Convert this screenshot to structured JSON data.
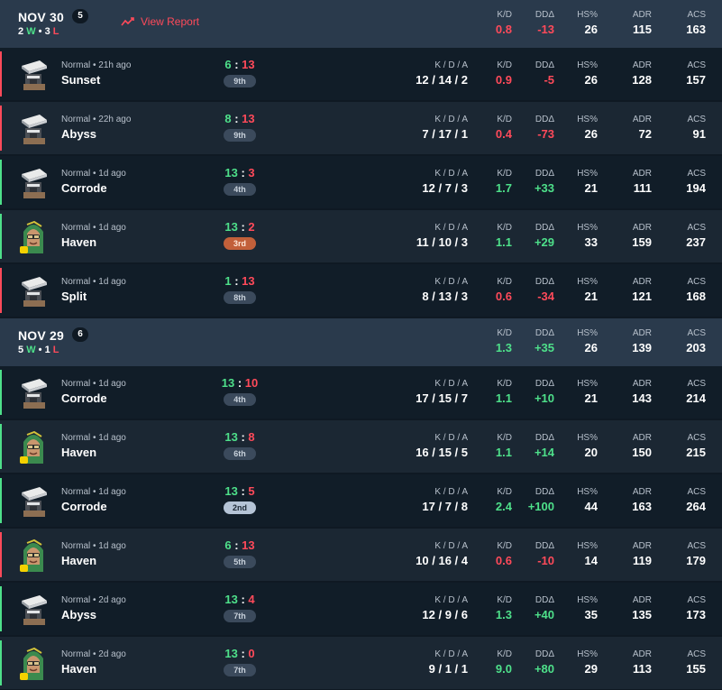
{
  "headers": [
    {
      "date": "NOV 30",
      "count": "5",
      "wins": "2",
      "w_letter": "W",
      "dot": "•",
      "losses": "3",
      "l_letter": "L",
      "view_report": "View Report",
      "stats": [
        {
          "label": "K/D",
          "value": "0.8",
          "tone": "red"
        },
        {
          "label": "DDΔ",
          "value": "-13",
          "tone": "red"
        },
        {
          "label": "HS%",
          "value": "26",
          "tone": "white"
        },
        {
          "label": "ADR",
          "value": "115",
          "tone": "white"
        },
        {
          "label": "ACS",
          "value": "163",
          "tone": "white"
        }
      ]
    },
    {
      "date": "NOV 29",
      "count": "6",
      "wins": "5",
      "w_letter": "W",
      "dot": "•",
      "losses": "1",
      "l_letter": "L",
      "view_report": "",
      "stats": [
        {
          "label": "K/D",
          "value": "1.3",
          "tone": "green"
        },
        {
          "label": "DDΔ",
          "value": "+35",
          "tone": "green"
        },
        {
          "label": "HS%",
          "value": "26",
          "tone": "white"
        },
        {
          "label": "ADR",
          "value": "139",
          "tone": "white"
        },
        {
          "label": "ACS",
          "value": "203",
          "tone": "white"
        }
      ]
    }
  ],
  "matches": [
    {
      "agent": "robot-agent-icon",
      "meta": "Normal • 21h ago",
      "map": "Sunset",
      "score_a": "6",
      "score_sep": ":",
      "score_b": "13",
      "result": "loss",
      "place": "9th",
      "kda_label": "K / D / A",
      "kda": "12 / 14 / 2",
      "kd": "0.9",
      "kd_tone": "red",
      "dd": "-5",
      "dd_tone": "red",
      "hs": "26",
      "adr": "128",
      "acs": "157"
    },
    {
      "agent": "robot-agent-icon",
      "meta": "Normal • 22h ago",
      "map": "Abyss",
      "score_a": "8",
      "score_sep": ":",
      "score_b": "13",
      "result": "loss",
      "place": "9th",
      "kda_label": "K / D / A",
      "kda": "7 / 17 / 1",
      "kd": "0.4",
      "kd_tone": "red",
      "dd": "-73",
      "dd_tone": "red",
      "hs": "26",
      "adr": "72",
      "acs": "91"
    },
    {
      "agent": "robot-agent-icon",
      "meta": "Normal • 1d ago",
      "map": "Corrode",
      "score_a": "13",
      "score_sep": ":",
      "score_b": "3",
      "result": "win",
      "place": "4th",
      "kda_label": "K / D / A",
      "kda": "12 / 7 / 3",
      "kd": "1.7",
      "kd_tone": "green",
      "dd": "+33",
      "dd_tone": "green",
      "hs": "21",
      "adr": "111",
      "acs": "194"
    },
    {
      "agent": "green-hood-agent-icon",
      "meta": "Normal • 1d ago",
      "map": "Haven",
      "score_a": "13",
      "score_sep": ":",
      "score_b": "2",
      "result": "win",
      "place": "3rd",
      "kda_label": "K / D / A",
      "kda": "11 / 10 / 3",
      "kd": "1.1",
      "kd_tone": "green",
      "dd": "+29",
      "dd_tone": "green",
      "hs": "33",
      "adr": "159",
      "acs": "237"
    },
    {
      "agent": "robot-agent-icon",
      "meta": "Normal • 1d ago",
      "map": "Split",
      "score_a": "1",
      "score_sep": ":",
      "score_b": "13",
      "result": "loss",
      "place": "8th",
      "kda_label": "K / D / A",
      "kda": "8 / 13 / 3",
      "kd": "0.6",
      "kd_tone": "red",
      "dd": "-34",
      "dd_tone": "red",
      "hs": "21",
      "adr": "121",
      "acs": "168"
    },
    {
      "agent": "robot-agent-icon",
      "meta": "Normal • 1d ago",
      "map": "Corrode",
      "score_a": "13",
      "score_sep": ":",
      "score_b": "10",
      "result": "win",
      "place": "4th",
      "kda_label": "K / D / A",
      "kda": "17 / 15 / 7",
      "kd": "1.1",
      "kd_tone": "green",
      "dd": "+10",
      "dd_tone": "green",
      "hs": "21",
      "adr": "143",
      "acs": "214"
    },
    {
      "agent": "green-hood-agent-icon",
      "meta": "Normal • 1d ago",
      "map": "Haven",
      "score_a": "13",
      "score_sep": ":",
      "score_b": "8",
      "result": "win",
      "place": "6th",
      "kda_label": "K / D / A",
      "kda": "16 / 15 / 5",
      "kd": "1.1",
      "kd_tone": "green",
      "dd": "+14",
      "dd_tone": "green",
      "hs": "20",
      "adr": "150",
      "acs": "215"
    },
    {
      "agent": "robot-agent-icon",
      "meta": "Normal • 1d ago",
      "map": "Corrode",
      "score_a": "13",
      "score_sep": ":",
      "score_b": "5",
      "result": "win",
      "place": "2nd",
      "kda_label": "K / D / A",
      "kda": "17 / 7 / 8",
      "kd": "2.4",
      "kd_tone": "green",
      "dd": "+100",
      "dd_tone": "green",
      "hs": "44",
      "adr": "163",
      "acs": "264"
    },
    {
      "agent": "green-hood-agent-icon",
      "meta": "Normal • 1d ago",
      "map": "Haven",
      "score_a": "6",
      "score_sep": ":",
      "score_b": "13",
      "result": "loss",
      "place": "5th",
      "kda_label": "K / D / A",
      "kda": "10 / 16 / 4",
      "kd": "0.6",
      "kd_tone": "red",
      "dd": "-10",
      "dd_tone": "red",
      "hs": "14",
      "adr": "119",
      "acs": "179"
    },
    {
      "agent": "robot-agent-icon",
      "meta": "Normal • 2d ago",
      "map": "Abyss",
      "score_a": "13",
      "score_sep": ":",
      "score_b": "4",
      "result": "win",
      "place": "7th",
      "kda_label": "K / D / A",
      "kda": "12 / 9 / 6",
      "kd": "1.3",
      "kd_tone": "green",
      "dd": "+40",
      "dd_tone": "green",
      "hs": "35",
      "adr": "135",
      "acs": "173"
    },
    {
      "agent": "green-hood-agent-icon",
      "meta": "Normal • 2d ago",
      "map": "Haven",
      "score_a": "13",
      "score_sep": ":",
      "score_b": "0",
      "result": "win",
      "place": "7th",
      "kda_label": "K / D / A",
      "kda": "9 / 1 / 1",
      "kd": "9.0",
      "kd_tone": "green",
      "dd": "+80",
      "dd_tone": "green",
      "hs": "29",
      "adr": "113",
      "acs": "155"
    }
  ],
  "stat_labels": {
    "kd": "K/D",
    "dd": "DDΔ",
    "hs": "HS%",
    "adr": "ADR",
    "acs": "ACS"
  },
  "colors": {
    "win": "#4ee08a",
    "loss": "#ff4a5a",
    "header_bg": "#2a3a4c",
    "row_odd": "#111d28",
    "row_even": "#1b2733"
  }
}
